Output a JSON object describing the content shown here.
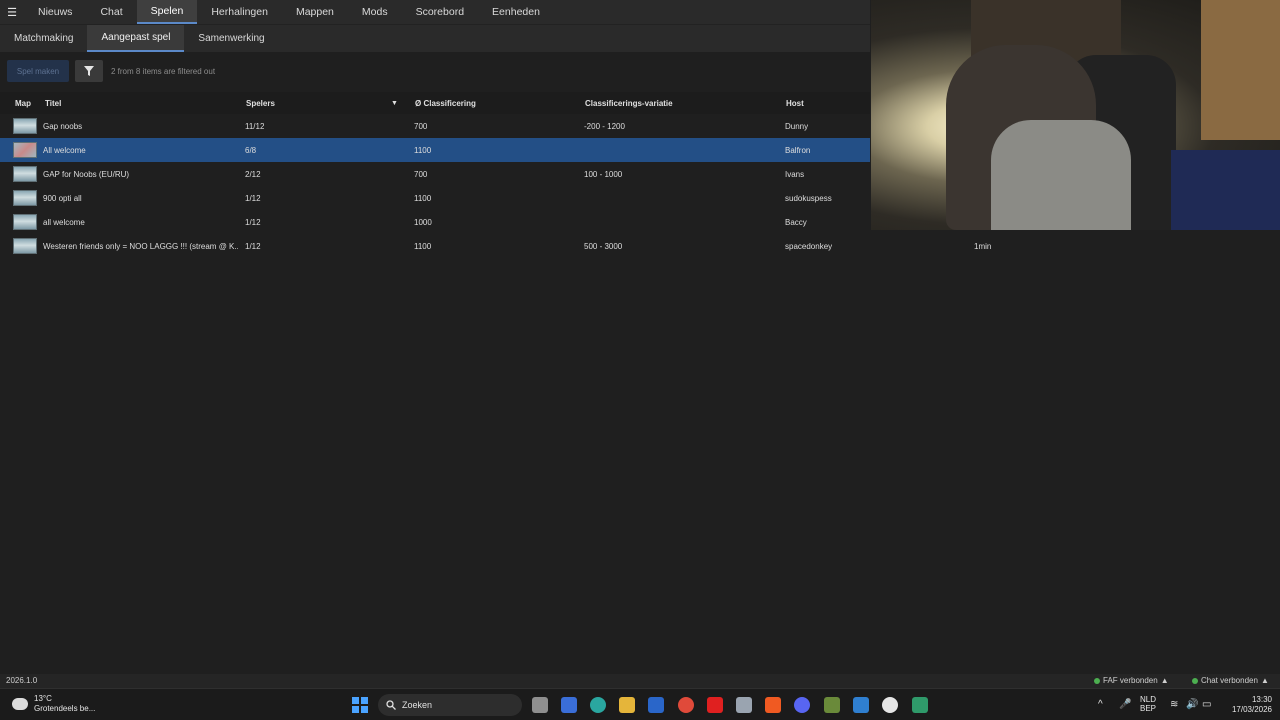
{
  "topnav": {
    "menu_icon": "hamburger-icon",
    "tabs": [
      {
        "label": "Nieuws"
      },
      {
        "label": "Chat"
      },
      {
        "label": "Spelen",
        "active": true
      },
      {
        "label": "Herhalingen"
      },
      {
        "label": "Mappen"
      },
      {
        "label": "Mods"
      },
      {
        "label": "Scorebord"
      },
      {
        "label": "Eenheden"
      }
    ]
  },
  "subnav": {
    "tabs": [
      {
        "label": "Matchmaking"
      },
      {
        "label": "Aangepast spel",
        "active": true
      },
      {
        "label": "Samenwerking"
      }
    ]
  },
  "toolbar": {
    "create_label": "Spel maken",
    "filter_icon": "filter-icon",
    "filter_note": "2 from 8 items are filtered out"
  },
  "table": {
    "headers": {
      "map": "Map",
      "title": "Titel",
      "players": "Spelers",
      "rating": "Ø Classificering",
      "variance": "Classificerings-variatie",
      "host": "Host"
    },
    "sort_icon": "sort-desc-icon",
    "rows": [
      {
        "title": "Gap noobs",
        "players": "11/12",
        "rating": "700",
        "variance": "-200 - 1200",
        "host": "Dunny",
        "extra": ""
      },
      {
        "title": "All welcome",
        "players": "6/8",
        "rating": "1100",
        "variance": "",
        "host": "Balfron",
        "extra": "",
        "selected": true
      },
      {
        "title": "GAP for Noobs (EU/RU)",
        "players": "2/12",
        "rating": "700",
        "variance": "100 - 1000",
        "host": "Ivans",
        "extra": ""
      },
      {
        "title": "900 opti all",
        "players": "1/12",
        "rating": "1100",
        "variance": "",
        "host": "sudokuspess",
        "extra": ""
      },
      {
        "title": "all welcome",
        "players": "1/12",
        "rating": "1000",
        "variance": "",
        "host": "Baccy",
        "extra": ""
      },
      {
        "title": "Westeren friends only = NOO LAGGG !!! (stream @ K...",
        "players": "1/12",
        "rating": "1100",
        "variance": "500 - 3000",
        "host": "spacedonkey",
        "extra": "1min"
      }
    ]
  },
  "statusbar": {
    "version": "2026.1.0",
    "faf_status": "FAF verbonden",
    "chat_status": "Chat verbonden",
    "status_color": "#4caf50"
  },
  "taskbar": {
    "weather_temp": "13°C",
    "weather_desc": "Grotendeels be...",
    "search_label": "Zoeken",
    "lang_top": "NLD",
    "lang_bottom": "BEP",
    "time": "13:30",
    "date": "17/03/2026"
  }
}
